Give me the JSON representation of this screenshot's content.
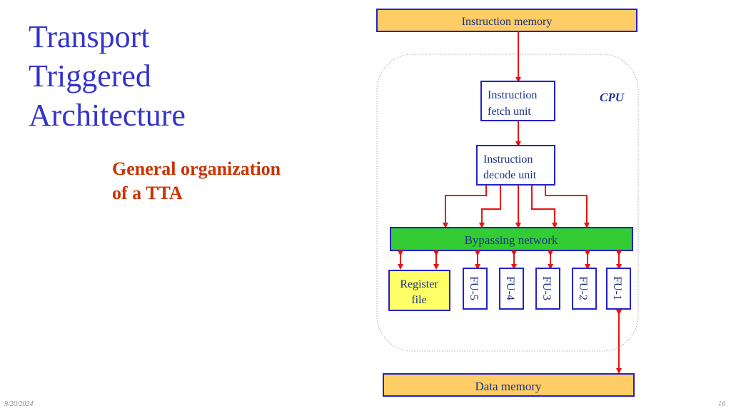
{
  "slide": {
    "title_lines": [
      "Transport",
      "Triggered",
      "Architecture"
    ],
    "subtitle_lines": [
      "General organization",
      "of a TTA"
    ],
    "date": "9/20/2024",
    "page_number": "16"
  },
  "diagram": {
    "cpu_label": "CPU",
    "instruction_memory": "Instruction memory",
    "fetch_unit": [
      "Instruction",
      "fetch unit"
    ],
    "decode_unit": [
      "Instruction",
      "decode unit"
    ],
    "bypassing_network": "Bypassing network",
    "register_file": [
      "Register",
      "file"
    ],
    "function_units": [
      "FU-5",
      "FU-4",
      "FU-3",
      "FU-2",
      "FU-1"
    ],
    "data_memory": "Data memory",
    "colors": {
      "memory_fill": "#ffcc66",
      "network_fill": "#33cc33",
      "register_fill": "#ffff66",
      "box_border": "#2222cc",
      "arrow": "#ee1111",
      "title": "#3333cc",
      "subtitle": "#cc3300"
    }
  }
}
